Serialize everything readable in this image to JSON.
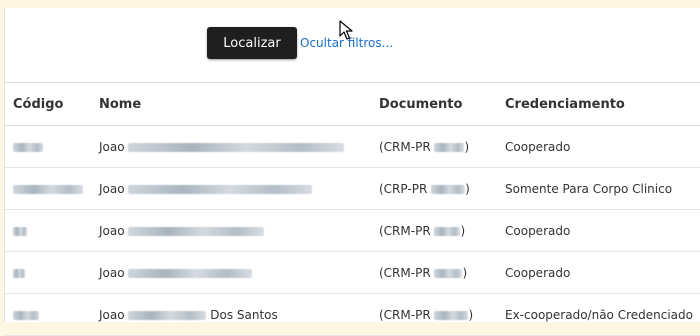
{
  "toolbar": {
    "search_button_label": "Localizar",
    "hide_filters_link": "Ocultar filtros..."
  },
  "table": {
    "columns": [
      "Código",
      "Nome",
      "Documento",
      "Credenciamento"
    ],
    "rows": [
      {
        "name_prefix": "Joao",
        "name_suffix": "",
        "doc_prefix": "(CRM-PR",
        "doc_suffix": ")",
        "credenciamento": "Cooperado"
      },
      {
        "name_prefix": "Joao",
        "name_suffix": "",
        "doc_prefix": "(CRP-PR",
        "doc_suffix": ")",
        "credenciamento": "Somente Para Corpo Clinico"
      },
      {
        "name_prefix": "Joao",
        "name_suffix": "",
        "doc_prefix": "(CRM-PR",
        "doc_suffix": ")",
        "credenciamento": "Cooperado"
      },
      {
        "name_prefix": "Joao",
        "name_suffix": "",
        "doc_prefix": "(CRM-PR",
        "doc_suffix": ")",
        "credenciamento": "Cooperado"
      },
      {
        "name_prefix": "Joao",
        "name_suffix": "Dos Santos",
        "doc_prefix": "(CRM-PR",
        "doc_suffix": ")",
        "credenciamento": "Ex-cooperado/não Credenciado"
      }
    ]
  },
  "colors": {
    "accent_link": "#1b6fc4",
    "button_bg": "#1f1f1f",
    "page_bg": "#fdf6e3"
  }
}
